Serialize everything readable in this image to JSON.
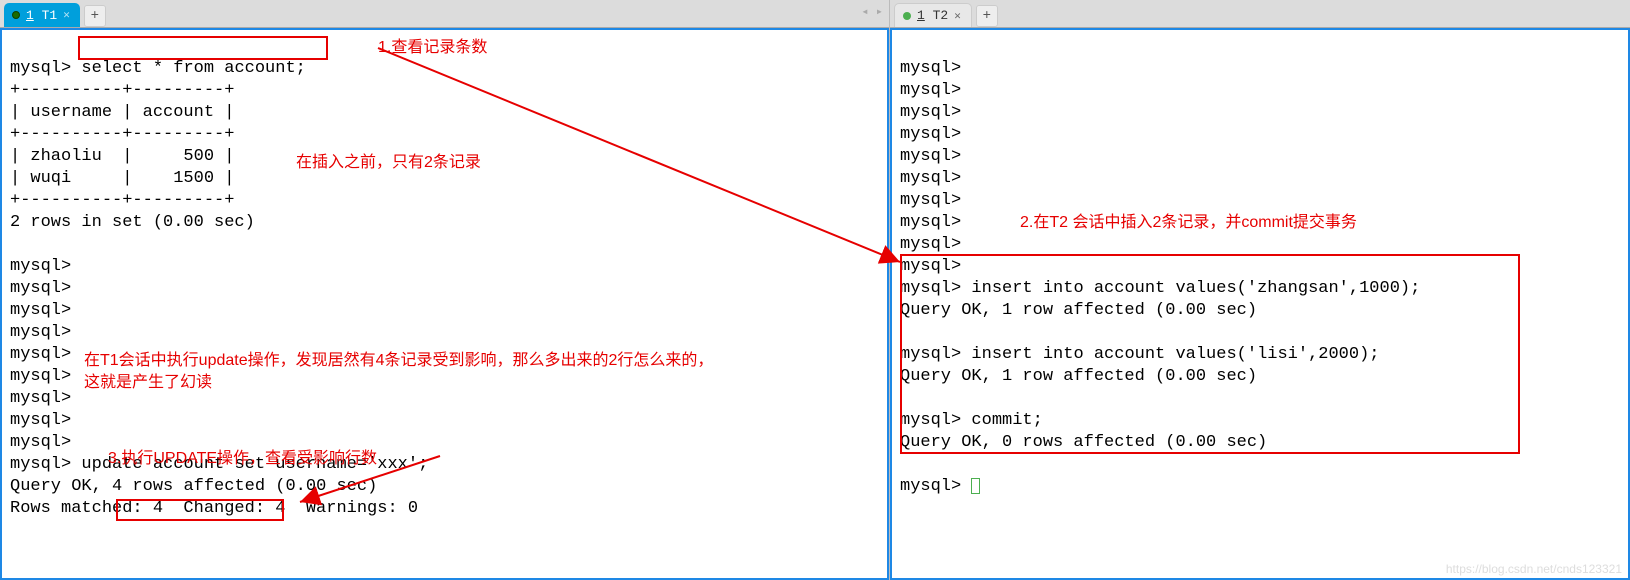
{
  "tabs": {
    "left": {
      "label": "1 T1",
      "prefix": "1",
      "name": "T1"
    },
    "right": {
      "label": "1 T2",
      "prefix": "1",
      "name": "T2"
    }
  },
  "left_terminal": {
    "prompt": "mysql>",
    "query": "select * from account;",
    "sep_top": "+----------+---------+",
    "header": "| username | account |",
    "sep_mid": "+----------+---------+",
    "row1": "| zhaoliu  |     500 |",
    "row2": "| wuqi     |    1500 |",
    "sep_bot": "+----------+---------+",
    "result_count": "2 rows in set (0.00 sec)",
    "update_stmt": "update account set username='xxx';",
    "update_ok": "Query OK, ",
    "update_affected": "4 rows affected",
    "update_tail": " (0.00 sec)",
    "rows_matched": "Rows matched: 4  Changed: 4  Warnings: 0"
  },
  "right_terminal": {
    "prompt": "mysql>",
    "insert1": "insert into account values('zhangsan',1000);",
    "insert1_ok": "Query OK, 1 row affected (0.00 sec)",
    "insert2": "insert into account values('lisi',2000);",
    "insert2_ok": "Query OK, 1 row affected (0.00 sec)",
    "commit": "commit;",
    "commit_ok": "Query OK, 0 rows affected (0.00 sec)"
  },
  "annotations": {
    "a1": "1.查看记录条数",
    "a2": "在插入之前，只有2条记录",
    "a3_line1": "在T1会话中执行update操作，发现居然有4条记录受到影响，那么多出来的2行怎么来的，",
    "a3_line2": "这就是产生了幻读",
    "a4": "3.执行UPDATE操作，查看受影响行数",
    "a5": "2.在T2 会话中插入2条记录，并commit提交事务"
  },
  "watermark": "https://blog.csdn.net/cnds123321"
}
